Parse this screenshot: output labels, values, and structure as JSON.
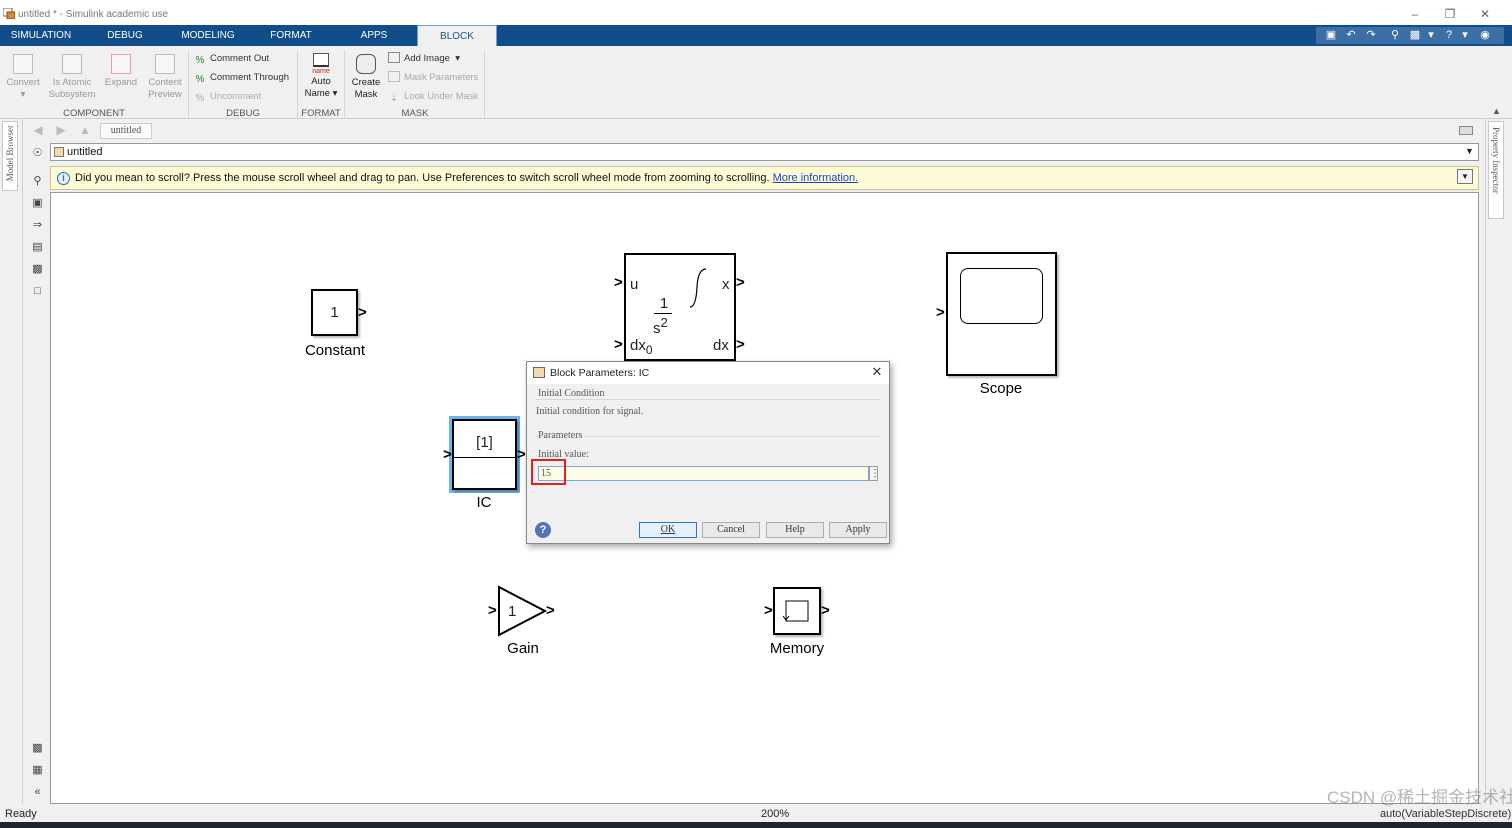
{
  "window": {
    "title": "untitled * - Simulink academic use",
    "controls": [
      "minimize",
      "restore",
      "close"
    ]
  },
  "ribbon_tabs": [
    {
      "label": "SIMULATION"
    },
    {
      "label": "DEBUG"
    },
    {
      "label": "MODELING"
    },
    {
      "label": "FORMAT"
    },
    {
      "label": "APPS"
    },
    {
      "label": "BLOCK",
      "active": true
    }
  ],
  "ribbon": {
    "component": {
      "group_label": "COMPONENT",
      "convert": "Convert",
      "is_atomic": [
        "Is Atomic",
        "Subsystem"
      ],
      "expand": "Expand",
      "content_preview": [
        "Content",
        "Preview"
      ]
    },
    "debug": {
      "group_label": "DEBUG",
      "comment_out": "Comment Out",
      "comment_through": "Comment Through",
      "uncomment": "Uncomment"
    },
    "format": {
      "group_label": "FORMAT",
      "icon_text": "name",
      "auto_name": [
        "Auto",
        "Name"
      ]
    },
    "mask": {
      "group_label": "MASK",
      "create_mask": [
        "Create",
        "Mask"
      ],
      "add_image": "Add Image",
      "mask_parameters": "Mask Parameters",
      "look_under_mask": "Look Under Mask"
    }
  },
  "side_panels": {
    "left": "Model Browser",
    "right": "Property Inspector"
  },
  "nav": {
    "tab": "untitled"
  },
  "address": {
    "path": "untitled"
  },
  "infobar": {
    "message": "Did you mean to scroll? Press the mouse scroll wheel and drag to pan. Use Preferences to switch scroll wheel mode from zooming to scrolling.",
    "link": "More information."
  },
  "blocks": {
    "constant": {
      "value": "1",
      "label": "Constant"
    },
    "integrator": {
      "in_u": "u",
      "in_dx0": "dx",
      "in_dx0_sub": "0",
      "out_x": "x",
      "out_dx": "dx",
      "numerator": "1",
      "denominator": "s",
      "denominator_exp": "2"
    },
    "scope": {
      "label": "Scope"
    },
    "ic": {
      "value": "[1]",
      "label": "IC"
    },
    "gain": {
      "value": "1",
      "label": "Gain"
    },
    "memory": {
      "label": "Memory"
    }
  },
  "dialog": {
    "title": "Block Parameters: IC",
    "section1_header": "Initial Condition",
    "section1_desc": "Initial condition for signal.",
    "section2_header": "Parameters",
    "field_label": "Initial value:",
    "field_value": "15",
    "buttons": {
      "ok": "OK",
      "cancel": "Cancel",
      "help": "Help",
      "apply": "Apply"
    }
  },
  "status": {
    "ready": "Ready",
    "zoom": "200%",
    "solver": "auto(VariableStepDiscrete)"
  },
  "watermark": "CSDN @稀土掘金技术社区"
}
